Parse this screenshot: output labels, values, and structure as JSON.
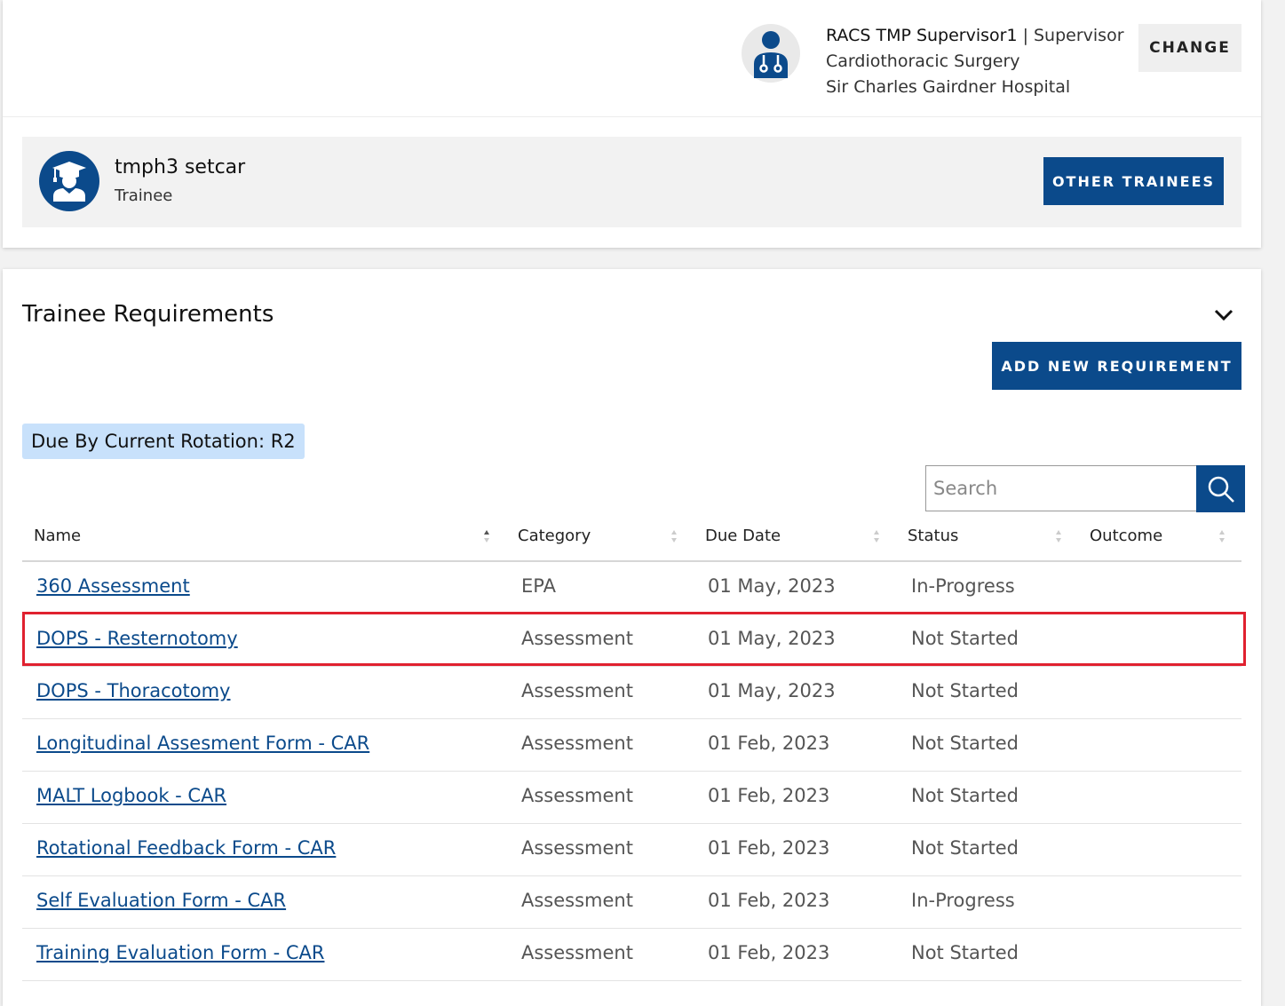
{
  "user": {
    "name": "RACS TMP Supervisor1",
    "separator": "|",
    "role": "Supervisor",
    "specialty": "Cardiothoracic Surgery",
    "hospital": "Sir Charles Gairdner Hospital",
    "change_label": "CHANGE"
  },
  "trainee": {
    "name": "tmph3 setcar",
    "role": "Trainee",
    "other_label": "OTHER TRAINEES"
  },
  "requirements": {
    "title": "Trainee Requirements",
    "add_label": "ADD NEW REQUIREMENT",
    "rotation_badge": "Due By Current Rotation:  R2",
    "search_placeholder": "Search",
    "columns": [
      "Name",
      "Category",
      "Due Date",
      "Status",
      "Outcome"
    ],
    "rows": [
      {
        "name": "360 Assessment",
        "category": "EPA",
        "due": "01 May, 2023",
        "status": "In-Progress",
        "outcome": ""
      },
      {
        "name": "DOPS - Resternotomy",
        "category": "Assessment",
        "due": "01 May, 2023",
        "status": "Not Started",
        "outcome": ""
      },
      {
        "name": "DOPS - Thoracotomy",
        "category": "Assessment",
        "due": "01 May, 2023",
        "status": "Not Started",
        "outcome": ""
      },
      {
        "name": "Longitudinal Assesment Form - CAR",
        "category": "Assessment",
        "due": "01 Feb, 2023",
        "status": "Not Started",
        "outcome": ""
      },
      {
        "name": "MALT Logbook - CAR",
        "category": "Assessment",
        "due": "01 Feb, 2023",
        "status": "Not Started",
        "outcome": ""
      },
      {
        "name": "Rotational Feedback Form - CAR",
        "category": "Assessment",
        "due": "01 Feb, 2023",
        "status": "Not Started",
        "outcome": ""
      },
      {
        "name": "Self Evaluation Form - CAR",
        "category": "Assessment",
        "due": "01 Feb, 2023",
        "status": "In-Progress",
        "outcome": ""
      },
      {
        "name": "Training Evaluation Form - CAR",
        "category": "Assessment",
        "due": "01 Feb, 2023",
        "status": "Not Started",
        "outcome": ""
      }
    ]
  },
  "colors": {
    "primary": "#0b4a8b",
    "badge": "#c8e1fb",
    "highlight": "#e0212f"
  }
}
